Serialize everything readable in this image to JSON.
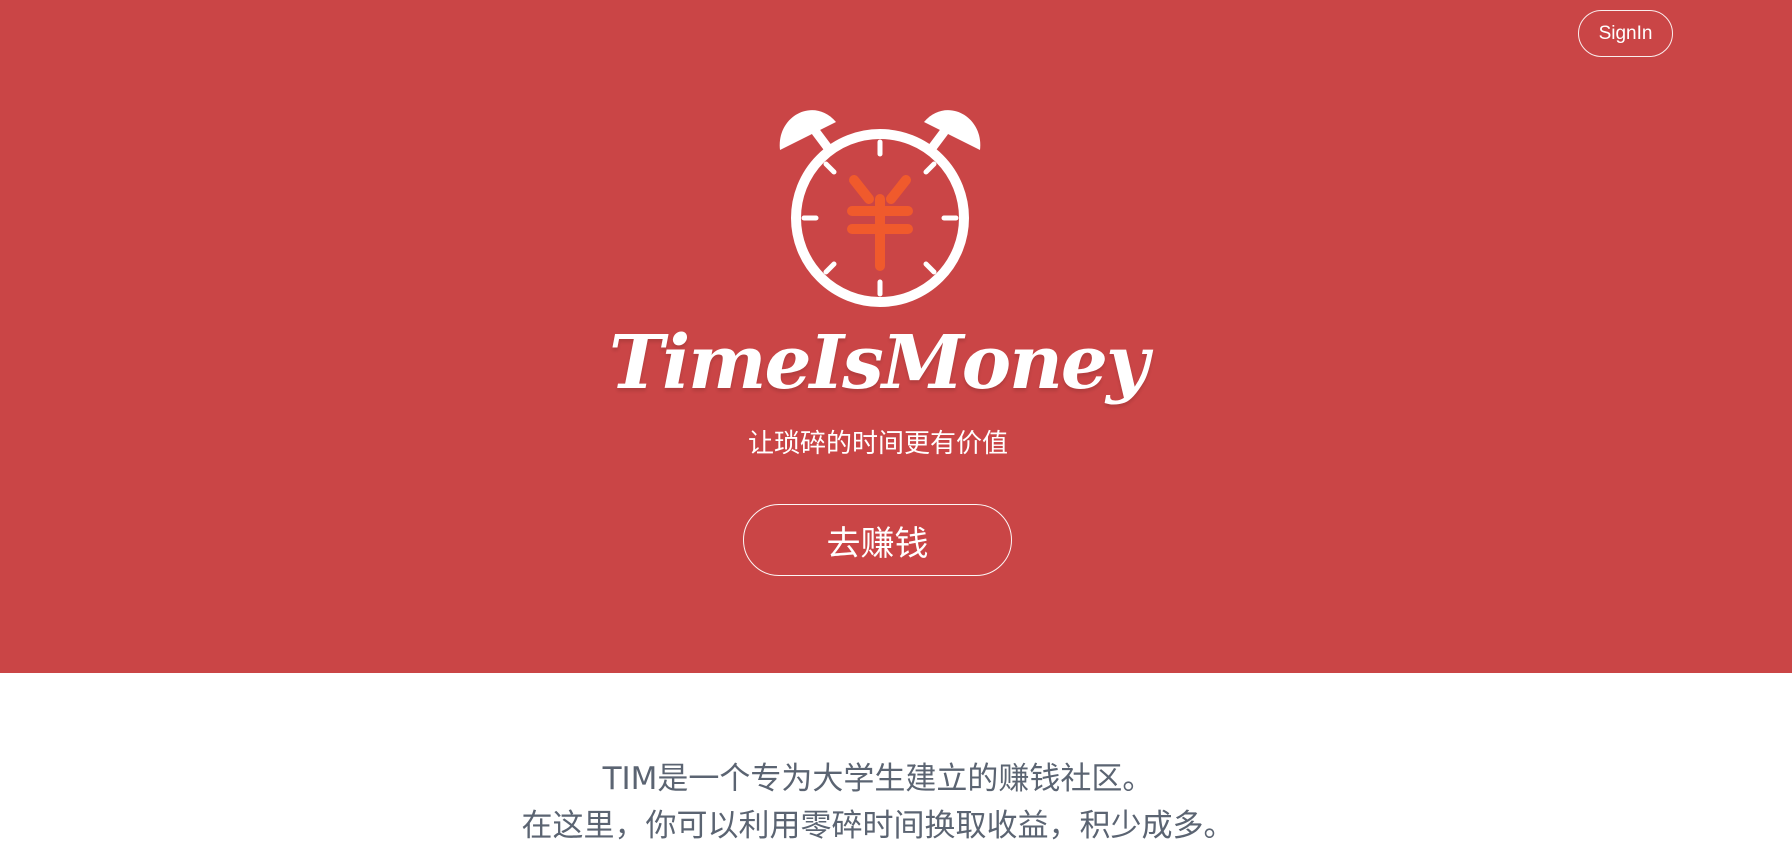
{
  "header": {
    "signin_label": "SignIn"
  },
  "hero": {
    "logo_icon": "alarm-clock-yuan-icon",
    "brand": "TimeIsMoney",
    "tagline": "让琐碎的时间更有价值",
    "cta_label": "去赚钱"
  },
  "intro": {
    "line1": "TIM是一个专为大学生建立的赚钱社区。",
    "line2": "在这里，你可以利用零碎时间换取收益，积少成多。"
  },
  "colors": {
    "hero_background": "#ca4546",
    "yuan_accent": "#f05a2c",
    "intro_text": "#5b6472"
  }
}
